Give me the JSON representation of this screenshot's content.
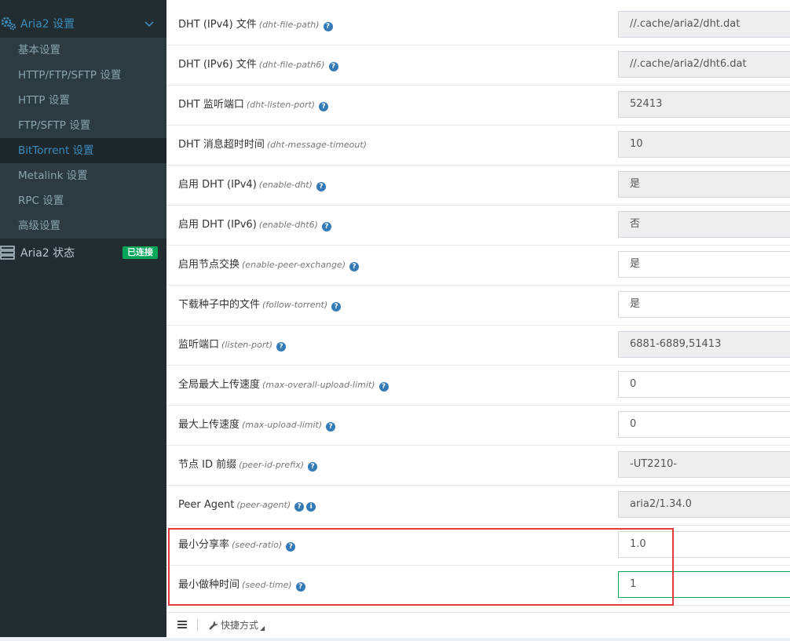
{
  "sidebar": {
    "group_title": "Aria2 设置",
    "items": [
      {
        "label": "基本设置",
        "active": false
      },
      {
        "label": "HTTP/FTP/SFTP 设置",
        "active": false
      },
      {
        "label": "HTTP 设置",
        "active": false
      },
      {
        "label": "FTP/SFTP 设置",
        "active": false
      },
      {
        "label": "BitTorrent 设置",
        "active": true
      },
      {
        "label": "Metalink 设置",
        "active": false
      },
      {
        "label": "RPC 设置",
        "active": false
      },
      {
        "label": "高级设置",
        "active": false
      }
    ],
    "status_title": "Aria2 状态",
    "status_badge": "已连接"
  },
  "settings": [
    {
      "label": "DHT (IPv4) 文件",
      "key": "(dht-file-path)",
      "value": "//.cache/aria2/dht.dat",
      "editable": false,
      "info": false
    },
    {
      "label": "DHT (IPv6) 文件",
      "key": "(dht-file-path6)",
      "value": "//.cache/aria2/dht6.dat",
      "editable": false,
      "info": false
    },
    {
      "label": "DHT 监听端口",
      "key": "(dht-listen-port)",
      "value": "52413",
      "editable": false,
      "info": false
    },
    {
      "label": "DHT 消息超时时间",
      "key": "(dht-message-timeout)",
      "value": "10",
      "editable": false,
      "info": false,
      "no_help": true
    },
    {
      "label": "启用 DHT (IPv4)",
      "key": "(enable-dht)",
      "value": "是",
      "editable": false,
      "info": false
    },
    {
      "label": "启用 DHT (IPv6)",
      "key": "(enable-dht6)",
      "value": "否",
      "editable": false,
      "info": false
    },
    {
      "label": "启用节点交换",
      "key": "(enable-peer-exchange)",
      "value": "是",
      "editable": true,
      "info": false
    },
    {
      "label": "下载种子中的文件",
      "key": "(follow-torrent)",
      "value": "是",
      "editable": true,
      "info": false
    },
    {
      "label": "监听端口",
      "key": "(listen-port)",
      "value": "6881-6889,51413",
      "editable": false,
      "info": false
    },
    {
      "label": "全局最大上传速度",
      "key": "(max-overall-upload-limit)",
      "value": "0",
      "editable": true,
      "info": false
    },
    {
      "label": "最大上传速度",
      "key": "(max-upload-limit)",
      "value": "0",
      "editable": true,
      "info": false
    },
    {
      "label": "节点 ID 前缀",
      "key": "(peer-id-prefix)",
      "value": "-UT2210-",
      "editable": false,
      "info": false
    },
    {
      "label": "Peer Agent",
      "key": "(peer-agent)",
      "value": "aria2/1.34.0",
      "editable": false,
      "info": true
    },
    {
      "label": "最小分享率",
      "key": "(seed-ratio)",
      "value": "1.0",
      "editable": true,
      "info": false
    },
    {
      "label": "最小做种时间",
      "key": "(seed-time)",
      "value": "1",
      "editable": true,
      "info": false,
      "focused": true
    }
  ],
  "footer": {
    "shortcut_label": "快捷方式"
  },
  "colors": {
    "sidebar_bg": "#222d32",
    "accent": "#3c8dbc",
    "badge_green": "#00a65a",
    "highlight_red": "#e23c3c"
  }
}
